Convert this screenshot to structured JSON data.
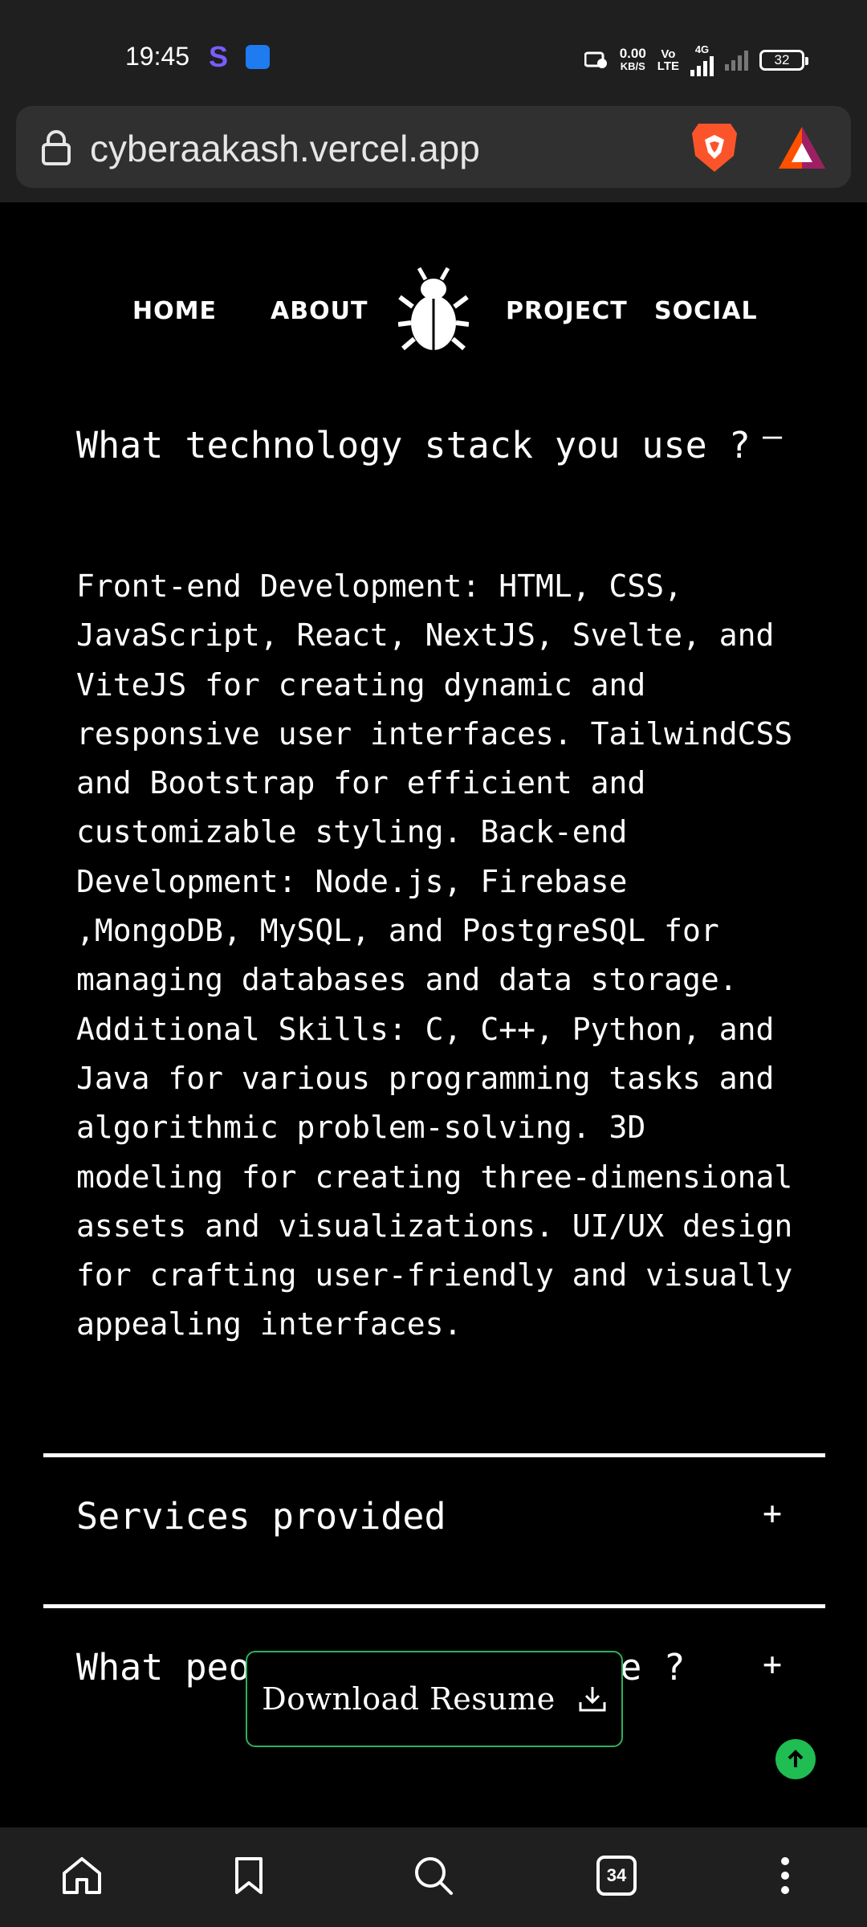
{
  "status_bar": {
    "time": "19:45",
    "app_letter": "S",
    "net_speed_value": "0.00",
    "net_speed_unit": "KB/S",
    "volte_top": "Vo",
    "volte_bottom": "LTE",
    "network_type": "4G",
    "battery": "32"
  },
  "browser": {
    "url": "cyberaakash.vercel.app",
    "tab_count": "34"
  },
  "nav": {
    "home": "HOME",
    "about": "ABOUT",
    "project": "PROJECT",
    "social": "SOCIAL"
  },
  "faq": {
    "q1": "What technology stack you use ?",
    "q1_toggle": "–",
    "a1": "Front-end Development: HTML, CSS, JavaScript, React, NextJS, Svelte, and ViteJS for creating dynamic and responsive user interfaces. TailwindCSS and Bootstrap for efficient and customizable styling. Back-end Development: Node.js, Firebase ,MongoDB, MySQL, and PostgreSQL for managing databases and data storage. Additional Skills: C, C++, Python, and Java for various programming tasks and algorithmic problem-solving. 3D modeling for creating three-dimensional assets and visualizations. UI/UX design for crafting user-friendly and visually appealing interfaces.",
    "q2": "Services provided",
    "q2_toggle": "+",
    "q3": "What people think about me ?",
    "q3_toggle": "+"
  },
  "download_button": {
    "label": "Download Resume"
  },
  "colors": {
    "accent_green": "#2fb15a",
    "background": "#000000",
    "chrome": "#1f1f1f"
  }
}
